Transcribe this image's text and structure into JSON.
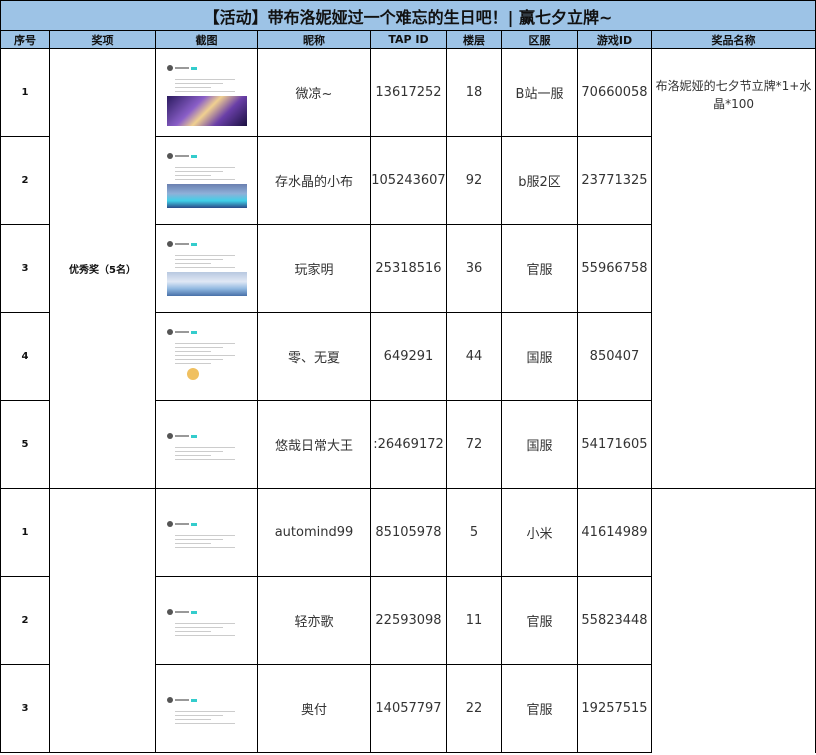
{
  "title": "【活动】带布洛妮娅过一个难忘的生日吧！| 赢七夕立牌~",
  "headers": [
    "序号",
    "奖项",
    "截图",
    "昵称",
    "TAP ID",
    "楼层",
    "区服",
    "游戏ID",
    "奖品名称"
  ],
  "groups": [
    {
      "award": "优秀奖（5名）",
      "prize": "布洛妮娅的七夕节立牌*1+水晶*100"
    },
    {
      "award": "",
      "prize": ""
    }
  ],
  "rows": [
    {
      "seq": "1",
      "nickname": "微凉~",
      "tap_id": "13617252",
      "floor": "18",
      "server": "B站一服",
      "game_id": "70660058",
      "thumb": "pic1"
    },
    {
      "seq": "2",
      "nickname": "存水晶的小布",
      "tap_id": "105243607",
      "floor": "92",
      "server": "b服2区",
      "game_id": "23771325",
      "thumb": "pic2"
    },
    {
      "seq": "3",
      "nickname": "玩家明",
      "tap_id": "25318516",
      "floor": "36",
      "server": "官服",
      "game_id": "55966758",
      "thumb": "pic3"
    },
    {
      "seq": "4",
      "nickname": "零、无夏",
      "tap_id": "649291",
      "floor": "44",
      "server": "国服",
      "game_id": "850407",
      "thumb": "emoji"
    },
    {
      "seq": "5",
      "nickname": "悠哉日常大王",
      "tap_id": ":26469172",
      "floor": "72",
      "server": "国服",
      "game_id": "54171605",
      "thumb": "text"
    },
    {
      "seq": "1",
      "nickname": "automind99",
      "tap_id": "85105978",
      "floor": "5",
      "server": "小米",
      "game_id": "41614989",
      "thumb": "text"
    },
    {
      "seq": "2",
      "nickname": "轻亦歌",
      "tap_id": "22593098",
      "floor": "11",
      "server": "官服",
      "game_id": "55823448",
      "thumb": "text"
    },
    {
      "seq": "3",
      "nickname": "奥付",
      "tap_id": "14057797",
      "floor": "22",
      "server": "官服",
      "game_id": "19257515",
      "thumb": "text"
    }
  ]
}
